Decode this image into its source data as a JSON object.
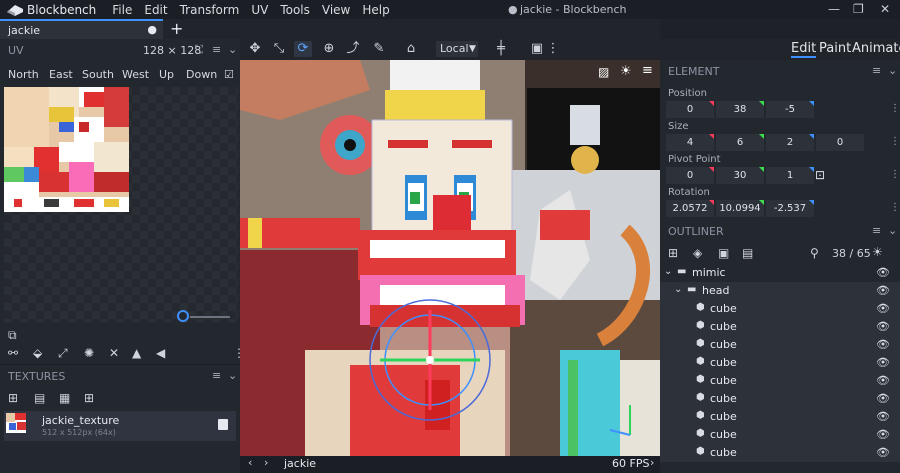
{
  "app": {
    "name": "Blockbench",
    "title": "jackie - Blockbench",
    "modified_dot": "●",
    "menu": [
      "File",
      "Edit",
      "Transform",
      "UV",
      "Tools",
      "View",
      "Help"
    ],
    "window_buttons": [
      "—",
      "❐",
      "✕"
    ]
  },
  "tabs": [
    {
      "label": "jackie",
      "modified": "●"
    }
  ],
  "tab_add": "+",
  "toolbar": {
    "pivot_space": "Local",
    "icons": [
      "move-arrows-icon",
      "resize-arrows-icon",
      "rotate-icon",
      "pivot-icon",
      "vertex-snap-icon",
      "brush-icon",
      "paint-bucket-icon"
    ]
  },
  "modes": {
    "edit": "Edit",
    "paint": "Paint",
    "animate": "Animate"
  },
  "uv": {
    "title": "UV",
    "size": "128 × 128",
    "faces": [
      "North",
      "East",
      "South",
      "West",
      "Up",
      "Down"
    ]
  },
  "textures": {
    "title": "TEXTURES",
    "items": [
      {
        "name": "jackie_texture",
        "meta": "512 x 512px (64x)"
      }
    ]
  },
  "element": {
    "title": "ELEMENT",
    "position": {
      "label": "Position",
      "values": [
        "0",
        "38",
        "-5"
      ]
    },
    "size": {
      "label": "Size",
      "values": [
        "4",
        "6",
        "2",
        "0"
      ]
    },
    "pivot": {
      "label": "Pivot Point",
      "values": [
        "0",
        "30",
        "1"
      ]
    },
    "rotation": {
      "label": "Rotation",
      "values": [
        "2.0572",
        "10.0994",
        "-2.537"
      ]
    },
    "axis_colors": [
      "#ff3b5c",
      "#3ddc4b",
      "#3e90ff"
    ]
  },
  "outliner": {
    "title": "OUTLINER",
    "count": "38 / 65",
    "rows": [
      {
        "label": "mimic",
        "type": "folder",
        "depth": 0
      },
      {
        "label": "head",
        "type": "folder",
        "depth": 1
      },
      {
        "label": "cube",
        "type": "cube",
        "depth": 2
      },
      {
        "label": "cube",
        "type": "cube",
        "depth": 2
      },
      {
        "label": "cube",
        "type": "cube",
        "depth": 2
      },
      {
        "label": "cube",
        "type": "cube",
        "depth": 2
      },
      {
        "label": "cube",
        "type": "cube",
        "depth": 2
      },
      {
        "label": "cube",
        "type": "cube",
        "depth": 2
      },
      {
        "label": "cube",
        "type": "cube",
        "depth": 2
      },
      {
        "label": "cube",
        "type": "cube",
        "depth": 2
      },
      {
        "label": "cube",
        "type": "cube",
        "depth": 2
      }
    ]
  },
  "viewport": {
    "name": "jackie",
    "fps": "60 FPS"
  }
}
